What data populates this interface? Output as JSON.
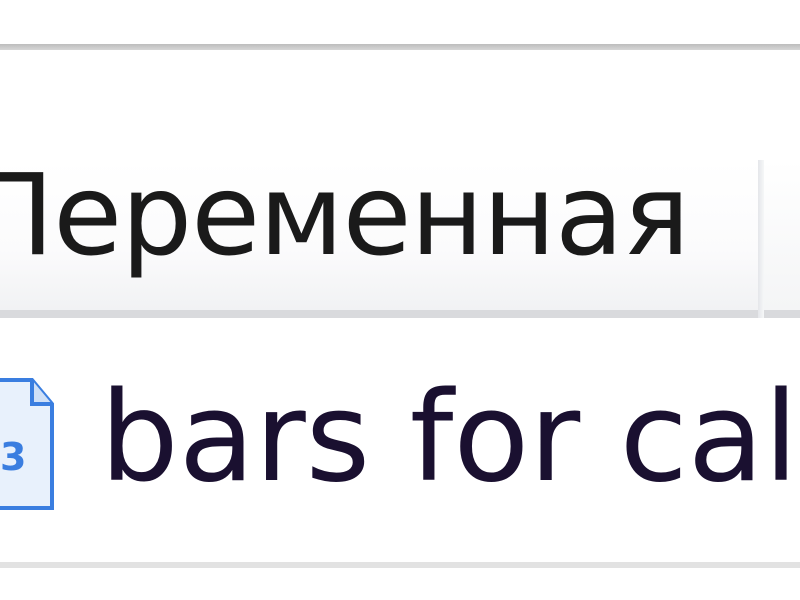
{
  "header": {
    "column_label": "Переменная"
  },
  "file": {
    "name": "bars for cal",
    "icon": "document-icon"
  },
  "colors": {
    "text": "#1a1a1a",
    "icon_blue": "#3a7ee0"
  }
}
